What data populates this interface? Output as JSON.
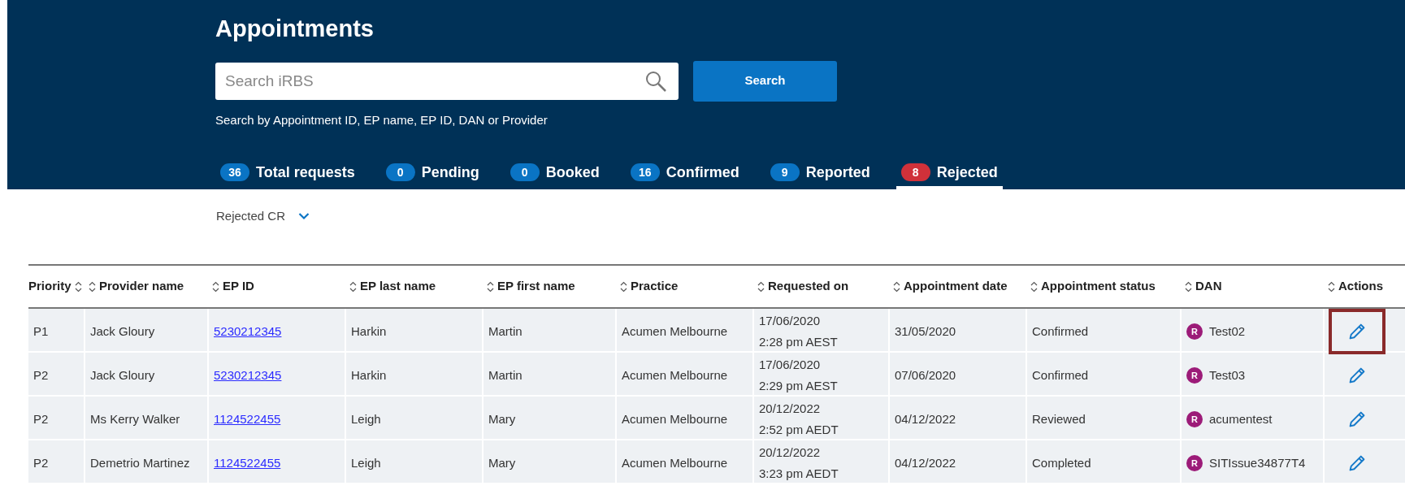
{
  "page_title": "Appointments",
  "search": {
    "placeholder": "Search iRBS",
    "button": "Search",
    "hint": "Search by Appointment ID, EP name, EP ID, DAN or Provider"
  },
  "tabs": [
    {
      "count": "36",
      "label": "Total requests",
      "selected": false
    },
    {
      "count": "0",
      "label": "Pending",
      "selected": false
    },
    {
      "count": "0",
      "label": "Booked",
      "selected": false
    },
    {
      "count": "16",
      "label": "Confirmed",
      "selected": false
    },
    {
      "count": "9",
      "label": "Reported",
      "selected": false
    },
    {
      "count": "8",
      "label": "Rejected",
      "selected": true
    }
  ],
  "filter": {
    "value": "Rejected CR"
  },
  "table": {
    "columns": [
      "Priority",
      "Provider name",
      "EP ID",
      "EP last name",
      "EP first name",
      "Practice",
      "Requested on",
      "Appointment date",
      "Appointment status",
      "DAN",
      "Actions"
    ],
    "rows": [
      {
        "priority": "P1",
        "provider": "Jack Gloury",
        "ep_id": "5230212345",
        "ep_last": "Harkin",
        "ep_first": "Martin",
        "practice": "Acumen Melbourne",
        "requested_date": "17/06/2020",
        "requested_time": "2:28 pm AEST",
        "appointment_date": "31/05/2020",
        "status": "Confirmed",
        "dan_badge": "R",
        "dan": "Test02",
        "highlighted": true
      },
      {
        "priority": "P2",
        "provider": "Jack Gloury",
        "ep_id": "5230212345",
        "ep_last": "Harkin",
        "ep_first": "Martin",
        "practice": "Acumen Melbourne",
        "requested_date": "17/06/2020",
        "requested_time": "2:29 pm AEST",
        "appointment_date": "07/06/2020",
        "status": "Confirmed",
        "dan_badge": "R",
        "dan": "Test03",
        "highlighted": false
      },
      {
        "priority": "P2",
        "provider": "Ms Kerry Walker",
        "ep_id": "1124522455",
        "ep_last": "Leigh",
        "ep_first": "Mary",
        "practice": "Acumen Melbourne",
        "requested_date": "20/12/2022",
        "requested_time": "2:52 pm AEDT",
        "appointment_date": "04/12/2022",
        "status": "Reviewed",
        "dan_badge": "R",
        "dan": "acumentest",
        "highlighted": false
      },
      {
        "priority": "P2",
        "provider": "Demetrio Martinez",
        "ep_id": "1124522455",
        "ep_last": "Leigh",
        "ep_first": "Mary",
        "practice": "Acumen Melbourne",
        "requested_date": "20/12/2022",
        "requested_time": "3:23 pm AEDT",
        "appointment_date": "04/12/2022",
        "status": "Completed",
        "dan_badge": "R",
        "dan": "SITIssue34877T4",
        "highlighted": false
      }
    ]
  }
}
